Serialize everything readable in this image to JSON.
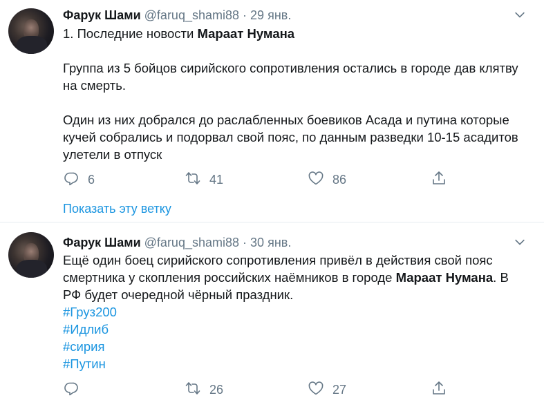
{
  "tweets": [
    {
      "name": "Фарук Шами",
      "handle": "@faruq_shami88",
      "separator": "·",
      "date": "29 янв.",
      "line1_prefix": "1. Последние новости ",
      "line1_bold": "Мараат Нумана",
      "para2": "Группа из 5 бойцов сирийского сопротивления остались в городе дав клятву на смерть.",
      "para3": "Один из них добрался до раслабленных боевиков Асада и путина которые кучей собрались и подорвал свой пояс, по данным разведки 10-15 асадитов улетели в отпуск",
      "reply_count": "6",
      "retweet_count": "41",
      "like_count": "86",
      "thread_link": "Показать эту ветку"
    },
    {
      "name": "Фарук Шами",
      "handle": "@faruq_shami88",
      "separator": "·",
      "date": "30 янв.",
      "text_prefix": "Ещё один боец сирийского сопротивления привёл в действия свой пояс смертника у скопления российских наёмников в городе ",
      "text_bold": "Мараат Нумана",
      "text_suffix": ". В РФ будет очередной чёрный праздник.",
      "hashtags": [
        "#Груз200",
        "#Идлиб",
        "#сирия",
        "#Путин"
      ],
      "reply_count": "",
      "retweet_count": "26",
      "like_count": "27"
    }
  ],
  "colors": {
    "link": "#1b95e0",
    "muted": "#657786",
    "text": "#14171a",
    "divider": "#e6ecf0"
  },
  "icons": [
    "avatar",
    "chevron-down-icon",
    "reply-icon",
    "retweet-icon",
    "like-icon",
    "share-icon"
  ]
}
